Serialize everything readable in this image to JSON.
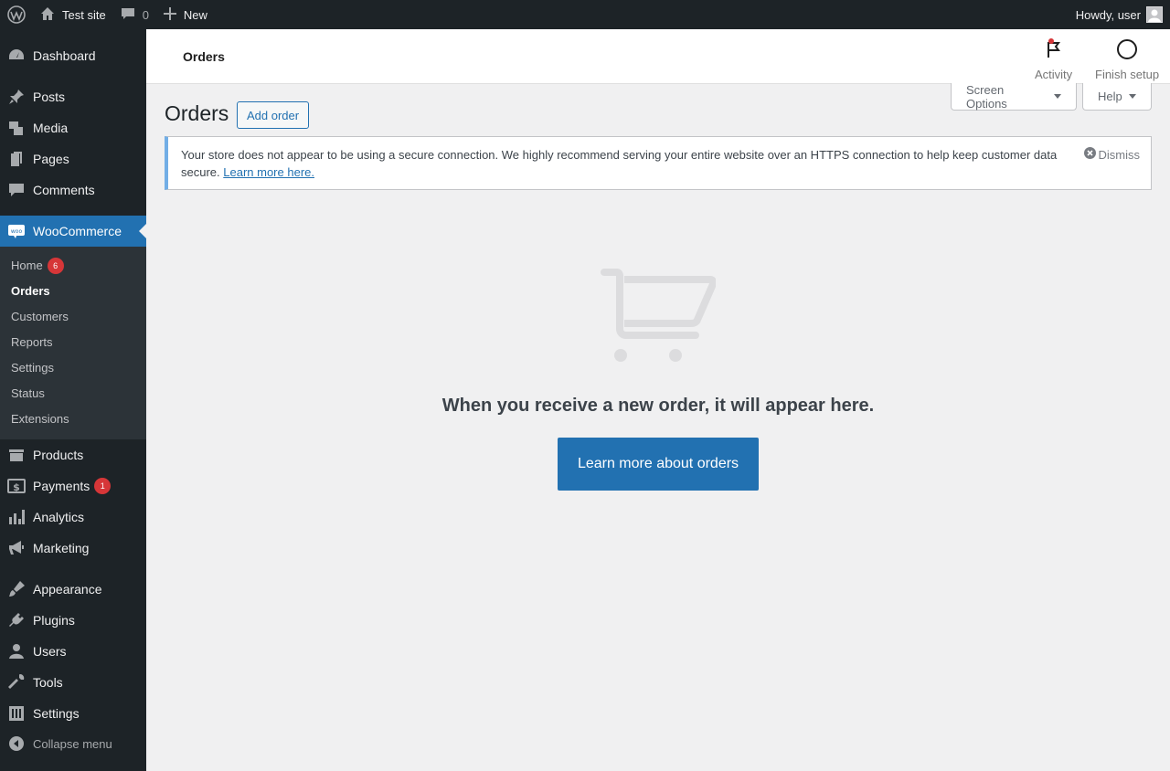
{
  "admin_bar": {
    "site_name": "Test site",
    "comments_count": "0",
    "new_label": "New",
    "greeting": "Howdy, user"
  },
  "sidebar": {
    "items": [
      {
        "label": "Dashboard",
        "icon": "dashboard-icon"
      },
      {
        "label": "Posts",
        "icon": "pin-icon"
      },
      {
        "label": "Media",
        "icon": "media-icon"
      },
      {
        "label": "Pages",
        "icon": "pages-icon"
      },
      {
        "label": "Comments",
        "icon": "comment-icon"
      },
      {
        "label": "WooCommerce",
        "icon": "woo-icon"
      },
      {
        "label": "Products",
        "icon": "archive-icon"
      },
      {
        "label": "Payments",
        "icon": "dollar-icon",
        "badge": "1"
      },
      {
        "label": "Analytics",
        "icon": "bar-chart-icon"
      },
      {
        "label": "Marketing",
        "icon": "megaphone-icon"
      },
      {
        "label": "Appearance",
        "icon": "brush-icon"
      },
      {
        "label": "Plugins",
        "icon": "plug-icon"
      },
      {
        "label": "Users",
        "icon": "user-icon"
      },
      {
        "label": "Tools",
        "icon": "wrench-icon"
      },
      {
        "label": "Settings",
        "icon": "sliders-icon"
      }
    ],
    "submenu": [
      {
        "label": "Home",
        "badge": "6"
      },
      {
        "label": "Orders"
      },
      {
        "label": "Customers"
      },
      {
        "label": "Reports"
      },
      {
        "label": "Settings"
      },
      {
        "label": "Status"
      },
      {
        "label": "Extensions"
      }
    ],
    "collapse_label": "Collapse menu"
  },
  "header": {
    "title": "Orders",
    "activity_label": "Activity",
    "finish_setup_label": "Finish setup"
  },
  "screen_options_label": "Screen Options",
  "help_label": "Help",
  "page": {
    "title": "Orders",
    "add_button": "Add order"
  },
  "notice": {
    "text": "Your store does not appear to be using a secure connection. We highly recommend serving your entire website over an HTTPS connection to help keep customer data secure.",
    "link": "Learn more here.",
    "dismiss": "Dismiss"
  },
  "empty_state": {
    "message": "When you receive a new order, it will appear here.",
    "button": "Learn more about orders"
  },
  "colors": {
    "accent": "#2271b1",
    "sidebar_bg": "#1d2327",
    "badge": "#d63638"
  }
}
